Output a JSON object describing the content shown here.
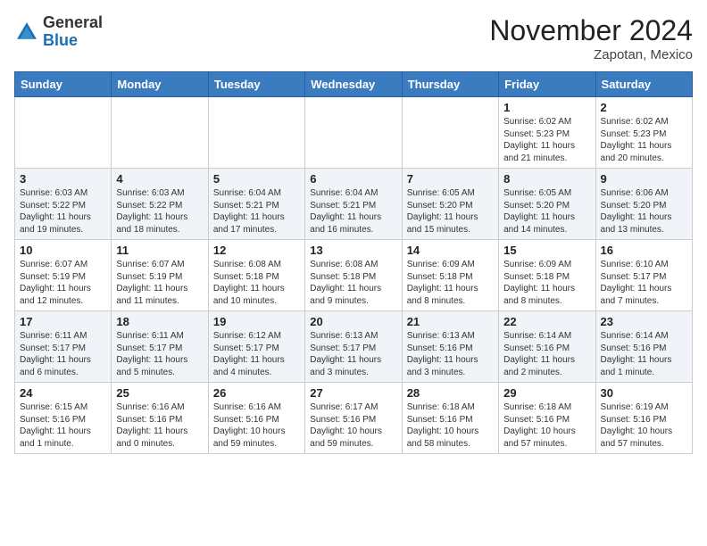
{
  "logo": {
    "general": "General",
    "blue": "Blue"
  },
  "header": {
    "month": "November 2024",
    "location": "Zapotan, Mexico"
  },
  "days_of_week": [
    "Sunday",
    "Monday",
    "Tuesday",
    "Wednesday",
    "Thursday",
    "Friday",
    "Saturday"
  ],
  "weeks": [
    [
      {
        "day": "",
        "info": ""
      },
      {
        "day": "",
        "info": ""
      },
      {
        "day": "",
        "info": ""
      },
      {
        "day": "",
        "info": ""
      },
      {
        "day": "",
        "info": ""
      },
      {
        "day": "1",
        "info": "Sunrise: 6:02 AM\nSunset: 5:23 PM\nDaylight: 11 hours and 21 minutes."
      },
      {
        "day": "2",
        "info": "Sunrise: 6:02 AM\nSunset: 5:23 PM\nDaylight: 11 hours and 20 minutes."
      }
    ],
    [
      {
        "day": "3",
        "info": "Sunrise: 6:03 AM\nSunset: 5:22 PM\nDaylight: 11 hours and 19 minutes."
      },
      {
        "day": "4",
        "info": "Sunrise: 6:03 AM\nSunset: 5:22 PM\nDaylight: 11 hours and 18 minutes."
      },
      {
        "day": "5",
        "info": "Sunrise: 6:04 AM\nSunset: 5:21 PM\nDaylight: 11 hours and 17 minutes."
      },
      {
        "day": "6",
        "info": "Sunrise: 6:04 AM\nSunset: 5:21 PM\nDaylight: 11 hours and 16 minutes."
      },
      {
        "day": "7",
        "info": "Sunrise: 6:05 AM\nSunset: 5:20 PM\nDaylight: 11 hours and 15 minutes."
      },
      {
        "day": "8",
        "info": "Sunrise: 6:05 AM\nSunset: 5:20 PM\nDaylight: 11 hours and 14 minutes."
      },
      {
        "day": "9",
        "info": "Sunrise: 6:06 AM\nSunset: 5:20 PM\nDaylight: 11 hours and 13 minutes."
      }
    ],
    [
      {
        "day": "10",
        "info": "Sunrise: 6:07 AM\nSunset: 5:19 PM\nDaylight: 11 hours and 12 minutes."
      },
      {
        "day": "11",
        "info": "Sunrise: 6:07 AM\nSunset: 5:19 PM\nDaylight: 11 hours and 11 minutes."
      },
      {
        "day": "12",
        "info": "Sunrise: 6:08 AM\nSunset: 5:18 PM\nDaylight: 11 hours and 10 minutes."
      },
      {
        "day": "13",
        "info": "Sunrise: 6:08 AM\nSunset: 5:18 PM\nDaylight: 11 hours and 9 minutes."
      },
      {
        "day": "14",
        "info": "Sunrise: 6:09 AM\nSunset: 5:18 PM\nDaylight: 11 hours and 8 minutes."
      },
      {
        "day": "15",
        "info": "Sunrise: 6:09 AM\nSunset: 5:18 PM\nDaylight: 11 hours and 8 minutes."
      },
      {
        "day": "16",
        "info": "Sunrise: 6:10 AM\nSunset: 5:17 PM\nDaylight: 11 hours and 7 minutes."
      }
    ],
    [
      {
        "day": "17",
        "info": "Sunrise: 6:11 AM\nSunset: 5:17 PM\nDaylight: 11 hours and 6 minutes."
      },
      {
        "day": "18",
        "info": "Sunrise: 6:11 AM\nSunset: 5:17 PM\nDaylight: 11 hours and 5 minutes."
      },
      {
        "day": "19",
        "info": "Sunrise: 6:12 AM\nSunset: 5:17 PM\nDaylight: 11 hours and 4 minutes."
      },
      {
        "day": "20",
        "info": "Sunrise: 6:13 AM\nSunset: 5:17 PM\nDaylight: 11 hours and 3 minutes."
      },
      {
        "day": "21",
        "info": "Sunrise: 6:13 AM\nSunset: 5:16 PM\nDaylight: 11 hours and 3 minutes."
      },
      {
        "day": "22",
        "info": "Sunrise: 6:14 AM\nSunset: 5:16 PM\nDaylight: 11 hours and 2 minutes."
      },
      {
        "day": "23",
        "info": "Sunrise: 6:14 AM\nSunset: 5:16 PM\nDaylight: 11 hours and 1 minute."
      }
    ],
    [
      {
        "day": "24",
        "info": "Sunrise: 6:15 AM\nSunset: 5:16 PM\nDaylight: 11 hours and 1 minute."
      },
      {
        "day": "25",
        "info": "Sunrise: 6:16 AM\nSunset: 5:16 PM\nDaylight: 11 hours and 0 minutes."
      },
      {
        "day": "26",
        "info": "Sunrise: 6:16 AM\nSunset: 5:16 PM\nDaylight: 10 hours and 59 minutes."
      },
      {
        "day": "27",
        "info": "Sunrise: 6:17 AM\nSunset: 5:16 PM\nDaylight: 10 hours and 59 minutes."
      },
      {
        "day": "28",
        "info": "Sunrise: 6:18 AM\nSunset: 5:16 PM\nDaylight: 10 hours and 58 minutes."
      },
      {
        "day": "29",
        "info": "Sunrise: 6:18 AM\nSunset: 5:16 PM\nDaylight: 10 hours and 57 minutes."
      },
      {
        "day": "30",
        "info": "Sunrise: 6:19 AM\nSunset: 5:16 PM\nDaylight: 10 hours and 57 minutes."
      }
    ]
  ]
}
